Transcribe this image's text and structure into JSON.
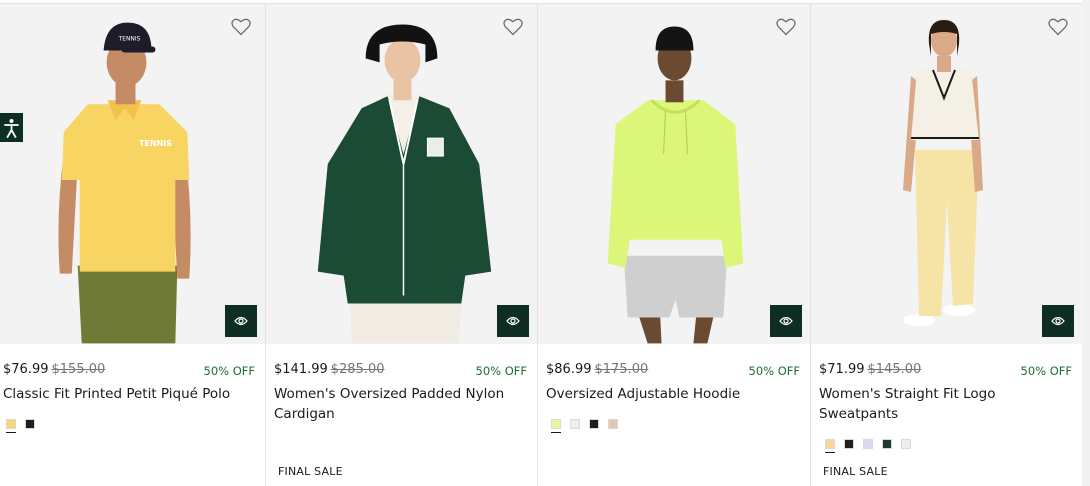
{
  "products": [
    {
      "price": "$76.99",
      "original_price": "$155.00",
      "discount": "50% OFF",
      "name": "Classic Fit Printed Petit Piqué Polo",
      "swatches": [
        "#f8d77a",
        "#1f1f1f"
      ],
      "final_sale": "",
      "image": {
        "bg": "#f3f3f3",
        "garment": "#f8d463",
        "pants": "#6f7a36",
        "cap_text": "TENNIS",
        "chest_text": "TENNIS"
      }
    },
    {
      "price": "$141.99",
      "original_price": "$285.00",
      "discount": "50% OFF",
      "name": "Women's Oversized Padded Nylon Cardigan",
      "swatches": [],
      "final_sale": "FINAL SALE",
      "image": {
        "bg": "#f3f3f3",
        "garment": "#1b4a35",
        "pants": "#f1ece3"
      }
    },
    {
      "price": "$86.99",
      "original_price": "$175.00",
      "discount": "50% OFF",
      "name": "Oversized Adjustable Hoodie",
      "swatches": [
        "#e6f2a6",
        "#eeeeee",
        "#1f1f1f",
        "#e2c6b6"
      ],
      "final_sale": "",
      "image": {
        "bg": "#f3f3f3",
        "garment": "#dcf67a",
        "pants": "#cfcfcf"
      }
    },
    {
      "price": "$71.99",
      "original_price": "$145.00",
      "discount": "50% OFF",
      "name": "Women's Straight Fit Logo Sweatpants",
      "swatches": [
        "#f8d79a",
        "#1f1f1f",
        "#d6d9f0",
        "#1d3a2d",
        "#eeeeee"
      ],
      "final_sale": "FINAL SALE",
      "image": {
        "bg": "#f3f3f3",
        "garment": "#f6e3a6",
        "top": "#f4f0e6"
      }
    }
  ],
  "icons": {
    "wishlist": "heart-outline-icon",
    "quick_view": "eye-icon",
    "accessibility": "accessibility-person-icon"
  },
  "colors": {
    "brand_dark_green": "#0f2e22",
    "discount_green": "#1c6b3a"
  }
}
